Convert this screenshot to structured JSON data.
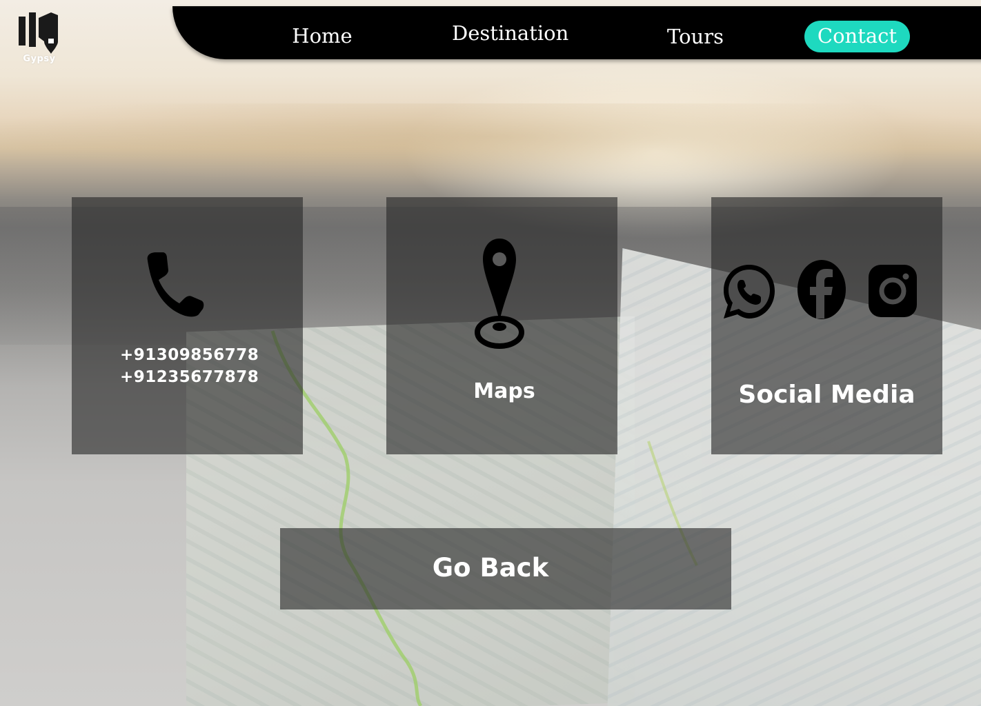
{
  "brand": {
    "logo_text": "Gypsy"
  },
  "nav": {
    "home": "Home",
    "destination": "Destination",
    "tours": "Tours",
    "contact": "Contact",
    "active": "Contact",
    "active_color": "#1ed9bf"
  },
  "cards": {
    "phone": {
      "icon": "phone-icon",
      "numbers": [
        "+91309856778",
        "+91235677878"
      ]
    },
    "maps": {
      "icon": "map-pin-icon",
      "label": "Maps"
    },
    "social": {
      "icons": [
        "whatsapp-icon",
        "facebook-icon",
        "instagram-icon"
      ],
      "label": "Social Media"
    }
  },
  "actions": {
    "go_back": "Go Back"
  },
  "colors": {
    "nav_bg": "#000000",
    "card_bg": "rgba(40,40,40,0.62)",
    "text": "#ffffff"
  }
}
